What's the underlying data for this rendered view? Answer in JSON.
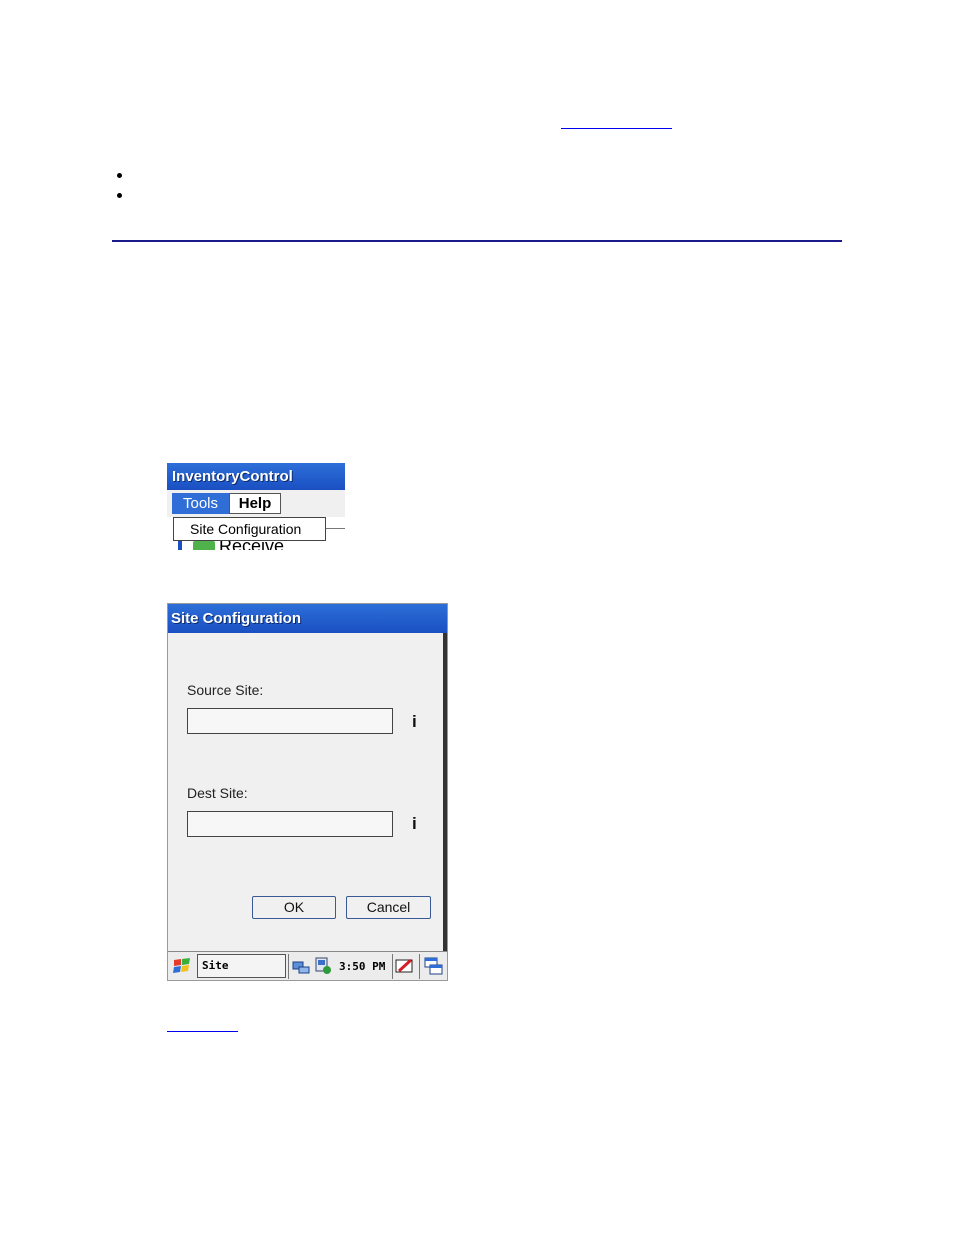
{
  "menu_screenshot": {
    "title": "InventoryControl",
    "menu_tools": "Tools",
    "menu_help": "Help",
    "dropdown_item": "Site Configuration",
    "partial_item": "Receive"
  },
  "dialog_screenshot": {
    "title": "Site Configuration",
    "source_label": "Source Site:",
    "dest_label": "Dest Site:",
    "source_value": "",
    "dest_value": "",
    "info_glyph": "i",
    "ok_label": "OK",
    "cancel_label": "Cancel",
    "taskbar": {
      "app_label": "Site Config...",
      "time": "3:50 PM"
    }
  },
  "colors": {
    "title_bar": "#1a4fc2",
    "rule": "#1a1a8c",
    "link": "#0000ee"
  }
}
